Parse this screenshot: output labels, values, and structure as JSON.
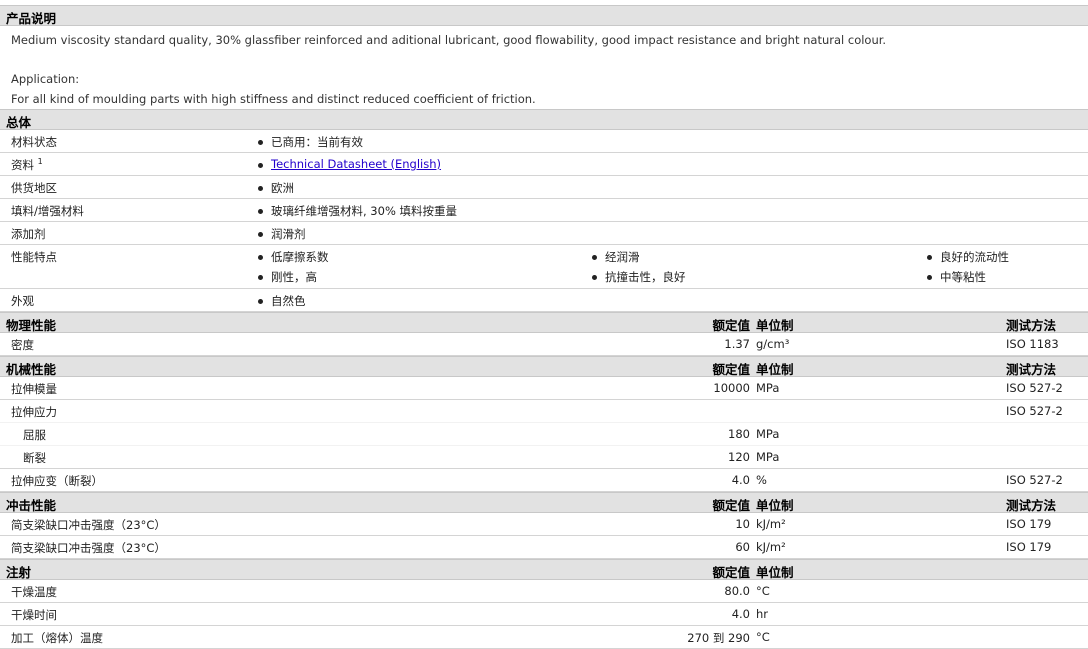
{
  "description": {
    "title": "产品说明",
    "lines": [
      "Medium viscosity standard quality, 30% glassfiber reinforced and aditional lubricant, good flowability, good impact resistance and bright natural colour.",
      "Application:",
      "For all kind of moulding parts with high stiffness and distinct reduced coefficient of friction."
    ]
  },
  "general": {
    "title": "总体",
    "rows": [
      {
        "label": "材料状态",
        "items": [
          "已商用：当前有效"
        ]
      },
      {
        "label": "资料",
        "sup": "1",
        "link": "Technical Datasheet (English)"
      },
      {
        "label": "供货地区",
        "items": [
          "欧洲"
        ]
      },
      {
        "label": "填料/增强材料",
        "items": [
          "玻璃纤维增强材料, 30% 填料按重量"
        ]
      },
      {
        "label": "添加剂",
        "items": [
          "润滑剂"
        ]
      },
      {
        "label": "性能特点",
        "items": [
          "低摩擦系数",
          "经润滑",
          "良好的流动性",
          "刚性，高",
          "抗撞击性，良好",
          "中等粘性"
        ]
      },
      {
        "label": "外观",
        "items": [
          "自然色"
        ]
      }
    ]
  },
  "headers": {
    "value": "额定值",
    "unit": "单位制",
    "method": "测试方法"
  },
  "sections": [
    {
      "title": "物理性能",
      "method": true,
      "rows": [
        {
          "label": "密度",
          "value": "1.37",
          "unit": "g/cm³",
          "method": "ISO 1183"
        }
      ]
    },
    {
      "title": "机械性能",
      "method": true,
      "rows": [
        {
          "label": "拉伸模量",
          "value": "10000",
          "unit": "MPa",
          "method": "ISO 527-2"
        },
        {
          "label": "拉伸应力",
          "value": "",
          "unit": "",
          "method": "ISO 527-2",
          "sub": true
        },
        {
          "label": "屈服",
          "value": "180",
          "unit": "MPa",
          "method": "",
          "indent": true
        },
        {
          "label": "断裂",
          "value": "120",
          "unit": "MPa",
          "method": "",
          "indent": true
        },
        {
          "label": "拉伸应变（断裂）",
          "value": "4.0",
          "unit": "%",
          "method": "ISO 527-2"
        }
      ]
    },
    {
      "title": "冲击性能",
      "method": true,
      "rows": [
        {
          "label": "简支梁缺口冲击强度（23°C）",
          "value": "10",
          "unit": "kJ/m²",
          "method": "ISO 179"
        },
        {
          "label": "简支梁缺口冲击强度（23°C）",
          "value": "60",
          "unit": "kJ/m²",
          "method": "ISO 179"
        }
      ]
    },
    {
      "title": "注射",
      "method": false,
      "rows": [
        {
          "label": "干燥温度",
          "value": "80.0",
          "unit": "°C",
          "method": ""
        },
        {
          "label": "干燥时间",
          "value": "4.0",
          "unit": "hr",
          "method": ""
        },
        {
          "label": "加工（熔体）温度",
          "value": "270 到  290",
          "unit": "°C",
          "method": ""
        }
      ]
    }
  ]
}
